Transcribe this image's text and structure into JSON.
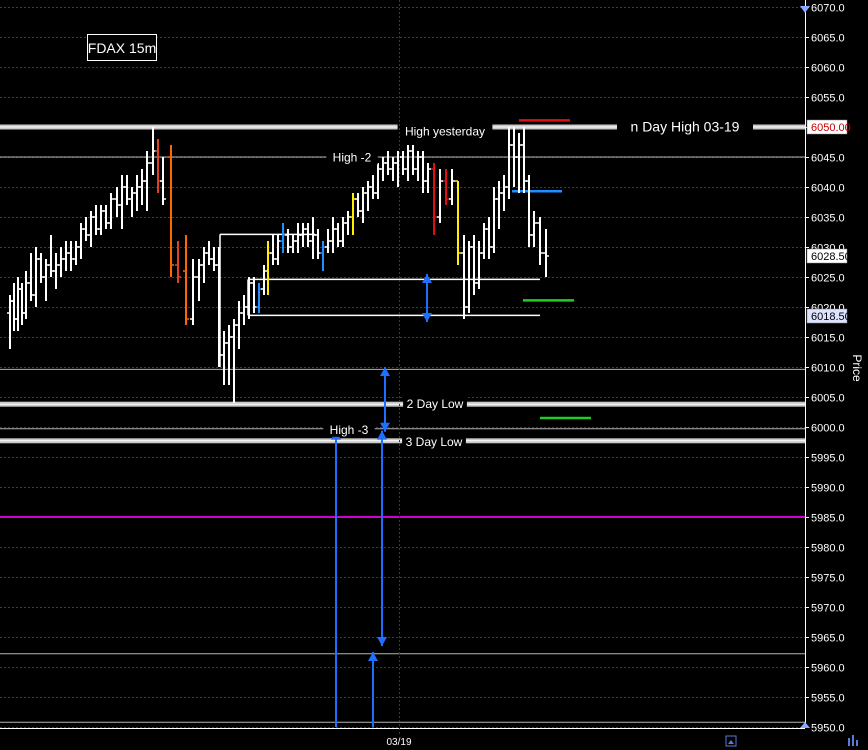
{
  "chart_data": {
    "type": "ohlc",
    "title": "FDAX 15m",
    "ylabel": "Price",
    "x_tick_label": "03/19",
    "ylim": [
      5950,
      6070
    ],
    "yticks": [
      5950,
      5955,
      5960,
      5965,
      5970,
      5975,
      5980,
      5985,
      5990,
      5995,
      6000,
      6005,
      6010,
      6015,
      6020,
      6025,
      6030,
      6035,
      6040,
      6045,
      6050,
      6055,
      6060,
      6065,
      6070
    ],
    "price_badges": [
      {
        "label": "6050.00",
        "value": 6050.0,
        "bg": "#ffffff",
        "fg": "#cc0000"
      },
      {
        "label": "6028.50",
        "value": 6028.5,
        "bg": "#ffffff",
        "fg": "#000000"
      },
      {
        "label": "6018.50",
        "value": 6018.5,
        "bg": "#dde2ff",
        "fg": "#000000"
      }
    ],
    "levels": [
      {
        "name": "High yesterday",
        "value": 6050.0,
        "label": "High yesterday",
        "label_price": 6049.4,
        "color": "#c8c8c8",
        "width": 3,
        "x_from": 0,
        "x_to": 1
      },
      {
        "name": "n Day High 03-19",
        "value": 6050.0,
        "label": "n Day High 03-19",
        "label_price": 6050.1,
        "color": "#c8c8c8",
        "width": 0,
        "x_from": 0,
        "x_to": 1
      },
      {
        "name": "High -2",
        "value": 6045.0,
        "label": "High -2",
        "label_price": 6045.1,
        "color": "#b4b4b4",
        "width": 1,
        "x_from": 0,
        "x_to": 1
      },
      {
        "name": "2 Day Low",
        "value": 6003.8,
        "label": "2 Day Low",
        "label_price": 6004.0,
        "color": "#c8c8c8",
        "width": 3,
        "x_from": 0,
        "x_to": 1
      },
      {
        "name": "High -3",
        "value": 5999.7,
        "label": "High -3",
        "label_price": 5999.7,
        "color": "#b4b4b4",
        "width": 1,
        "x_from": 0,
        "x_to": 1
      },
      {
        "name": "3 Day Low",
        "value": 5997.7,
        "label": "3 Day Low",
        "label_price": 5997.7,
        "color": "#c8c8c8",
        "width": 3,
        "x_from": 0,
        "x_to": 1
      },
      {
        "name": "magenta",
        "value": 5985.0,
        "label": "",
        "label_price": 5985.0,
        "color": "#d000d0",
        "width": 2,
        "x_from": 0,
        "x_to": 1
      },
      {
        "name": "line-6009",
        "value": 6009.6,
        "label": "",
        "label_price": 6009.6,
        "color": "#b4b4b4",
        "width": 1,
        "x_from": 0,
        "x_to": 1
      },
      {
        "name": "line-5962",
        "value": 5962.2,
        "label": "",
        "label_price": 5962.2,
        "color": "#b4b4b4",
        "width": 1,
        "x_from": 0,
        "x_to": 1
      },
      {
        "name": "line-5951",
        "value": 5950.8,
        "label": "",
        "label_price": 5950.8,
        "color": "#b4b4b4",
        "width": 1,
        "x_from": 0,
        "x_to": 1
      }
    ],
    "segments": [
      {
        "x1": 220,
        "x2": 315,
        "value": 6032.1,
        "color": "#ffffff"
      },
      {
        "x1": 248,
        "x2": 540,
        "value": 6024.6,
        "color": "#ffffff"
      },
      {
        "x1": 250,
        "x2": 540,
        "value": 6018.6,
        "color": "#ffffff"
      },
      {
        "x1": 519,
        "x2": 570,
        "value": 6051.1,
        "color": "#e01010"
      },
      {
        "x1": 512,
        "x2": 562,
        "value": 6039.3,
        "color": "#1e90ff"
      },
      {
        "x1": 523,
        "x2": 574,
        "value": 6021.1,
        "color": "#22cc22"
      },
      {
        "x1": 540,
        "x2": 591,
        "value": 6001.5,
        "color": "#22cc22"
      }
    ],
    "arrows": [
      {
        "x": 427,
        "v1": 6025.5,
        "v2": 6017.5,
        "type": "double",
        "color": "#1e6fff"
      },
      {
        "x": 385,
        "v1": 6010.0,
        "v2": 5999.2,
        "type": "double",
        "color": "#1e6fff"
      },
      {
        "x": 382,
        "v1": 5999.4,
        "v2": 5963.5,
        "type": "double",
        "color": "#1e6fff"
      },
      {
        "x": 336,
        "v1": 5950.0,
        "v2": 5999.4,
        "type": "up",
        "color": "#1e6fff"
      },
      {
        "x": 373,
        "v1": 5950.0,
        "v2": 5962.5,
        "type": "up",
        "color": "#1e6fff"
      }
    ],
    "bars": [
      {
        "x": 10,
        "o": 6019,
        "h": 6022,
        "l": 6013,
        "c": 6021,
        "color": "#ffffff"
      },
      {
        "x": 14,
        "o": 6021,
        "h": 6024,
        "l": 6016,
        "c": 6018,
        "color": "#ffffff"
      },
      {
        "x": 18,
        "o": 6018,
        "h": 6025,
        "l": 6016,
        "c": 6023,
        "color": "#ffffff"
      },
      {
        "x": 22,
        "o": 6023,
        "h": 6024,
        "l": 6017,
        "c": 6019,
        "color": "#ffffff"
      },
      {
        "x": 26,
        "o": 6019,
        "h": 6026,
        "l": 6018,
        "c": 6024,
        "color": "#ffffff"
      },
      {
        "x": 31,
        "o": 6024,
        "h": 6029,
        "l": 6021,
        "c": 6022,
        "color": "#ffffff"
      },
      {
        "x": 36,
        "o": 6022,
        "h": 6030,
        "l": 6020,
        "c": 6028,
        "color": "#ffffff"
      },
      {
        "x": 41,
        "o": 6028,
        "h": 6029,
        "l": 6024,
        "c": 6025,
        "color": "#ffffff"
      },
      {
        "x": 46,
        "o": 6025,
        "h": 6028,
        "l": 6021,
        "c": 6027,
        "color": "#ffffff"
      },
      {
        "x": 51,
        "o": 6027,
        "h": 6032,
        "l": 6025,
        "c": 6026,
        "color": "#ffffff"
      },
      {
        "x": 56,
        "o": 6026,
        "h": 6029,
        "l": 6023,
        "c": 6027,
        "color": "#ffffff"
      },
      {
        "x": 61,
        "o": 6027,
        "h": 6030,
        "l": 6025,
        "c": 6028,
        "color": "#ffffff"
      },
      {
        "x": 66,
        "o": 6028,
        "h": 6031,
        "l": 6026,
        "c": 6029,
        "color": "#ffffff"
      },
      {
        "x": 71,
        "o": 6029,
        "h": 6031,
        "l": 6026,
        "c": 6028,
        "color": "#ffffff"
      },
      {
        "x": 76,
        "o": 6028,
        "h": 6031,
        "l": 6027,
        "c": 6030,
        "color": "#ffffff"
      },
      {
        "x": 81,
        "o": 6030,
        "h": 6034,
        "l": 6028,
        "c": 6033,
        "color": "#ffffff"
      },
      {
        "x": 86,
        "o": 6033,
        "h": 6035,
        "l": 6031,
        "c": 6032,
        "color": "#ffffff"
      },
      {
        "x": 91,
        "o": 6032,
        "h": 6036,
        "l": 6030,
        "c": 6035,
        "color": "#ffffff"
      },
      {
        "x": 96,
        "o": 6035,
        "h": 6037,
        "l": 6032,
        "c": 6033,
        "color": "#ffffff"
      },
      {
        "x": 101,
        "o": 6033,
        "h": 6037,
        "l": 6032,
        "c": 6036,
        "color": "#ffffff"
      },
      {
        "x": 106,
        "o": 6036,
        "h": 6037,
        "l": 6033,
        "c": 6034,
        "color": "#ffffff"
      },
      {
        "x": 111,
        "o": 6034,
        "h": 6039,
        "l": 6033,
        "c": 6038,
        "color": "#ffffff"
      },
      {
        "x": 117,
        "o": 6038,
        "h": 6040,
        "l": 6035,
        "c": 6037,
        "color": "#ffffff"
      },
      {
        "x": 122,
        "o": 6037,
        "h": 6042,
        "l": 6033,
        "c": 6040,
        "color": "#ffffff"
      },
      {
        "x": 127,
        "o": 6040,
        "h": 6042,
        "l": 6037,
        "c": 6038,
        "color": "#ffffff"
      },
      {
        "x": 132,
        "o": 6038,
        "h": 6040,
        "l": 6035,
        "c": 6039,
        "color": "#ffffff"
      },
      {
        "x": 137,
        "o": 6039,
        "h": 6042,
        "l": 6036,
        "c": 6040,
        "color": "#ffffff"
      },
      {
        "x": 142,
        "o": 6040,
        "h": 6043,
        "l": 6037,
        "c": 6041,
        "color": "#ffffff"
      },
      {
        "x": 147,
        "o": 6041,
        "h": 6046,
        "l": 6036,
        "c": 6044,
        "color": "#ffffff"
      },
      {
        "x": 153,
        "o": 6044,
        "h": 6050,
        "l": 6042,
        "c": 6046,
        "color": "#ffffff"
      },
      {
        "x": 158,
        "o": 6046,
        "h": 6048,
        "l": 6039,
        "c": 6041,
        "color": "#e04020"
      },
      {
        "x": 163,
        "o": 6041,
        "h": 6045,
        "l": 6037,
        "c": 6038,
        "color": "#ffffff"
      },
      {
        "x": 171,
        "o": 6045,
        "h": 6047,
        "l": 6025,
        "c": 6027,
        "color": "#ff6600"
      },
      {
        "x": 178,
        "o": 6027,
        "h": 6031,
        "l": 6024,
        "c": 6025,
        "color": "#e04020"
      },
      {
        "x": 186,
        "o": 6026,
        "h": 6032,
        "l": 6017,
        "c": 6018,
        "color": "#ff6600"
      },
      {
        "x": 193,
        "o": 6018,
        "h": 6028,
        "l": 6017,
        "c": 6025,
        "color": "#ffffff"
      },
      {
        "x": 199,
        "o": 6025,
        "h": 6028,
        "l": 6021,
        "c": 6027,
        "color": "#ffffff"
      },
      {
        "x": 204,
        "o": 6027,
        "h": 6030,
        "l": 6024,
        "c": 6029,
        "color": "#ffffff"
      },
      {
        "x": 209,
        "o": 6029,
        "h": 6031,
        "l": 6027,
        "c": 6028,
        "color": "#ffffff"
      },
      {
        "x": 214,
        "o": 6028,
        "h": 6030,
        "l": 6026,
        "c": 6027,
        "color": "#ffffff"
      },
      {
        "x": 219,
        "o": 6027,
        "h": 6030,
        "l": 6010,
        "c": 6012,
        "color": "#ffffff"
      },
      {
        "x": 224,
        "o": 6012,
        "h": 6016,
        "l": 6007,
        "c": 6014,
        "color": "#ffffff"
      },
      {
        "x": 229,
        "o": 6014,
        "h": 6017,
        "l": 6007,
        "c": 6015,
        "color": "#ffffff"
      },
      {
        "x": 234,
        "o": 6015,
        "h": 6018,
        "l": 6004,
        "c": 6017,
        "color": "#ffffff"
      },
      {
        "x": 239,
        "o": 6017,
        "h": 6021,
        "l": 6013,
        "c": 6019,
        "color": "#ffffff"
      },
      {
        "x": 244,
        "o": 6019,
        "h": 6022,
        "l": 6017,
        "c": 6020,
        "color": "#ffffff"
      },
      {
        "x": 249,
        "o": 6020,
        "h": 6025,
        "l": 6018,
        "c": 6024,
        "color": "#ffffff"
      },
      {
        "x": 254,
        "o": 6024,
        "h": 6025,
        "l": 6019,
        "c": 6020,
        "color": "#ffffff"
      },
      {
        "x": 259,
        "o": 6020,
        "h": 6024,
        "l": 6019,
        "c": 6023,
        "color": "#1e90ff"
      },
      {
        "x": 264,
        "o": 6023,
        "h": 6027,
        "l": 6022,
        "c": 6026,
        "color": "#ffffff"
      },
      {
        "x": 268,
        "o": 6026,
        "h": 6031,
        "l": 6022,
        "c": 6029,
        "color": "#ffee00"
      },
      {
        "x": 273,
        "o": 6029,
        "h": 6032,
        "l": 6027,
        "c": 6028,
        "color": "#ffffff"
      },
      {
        "x": 278,
        "o": 6028,
        "h": 6032,
        "l": 6027,
        "c": 6031,
        "color": "#ffffff"
      },
      {
        "x": 283,
        "o": 6031,
        "h": 6034,
        "l": 6029,
        "c": 6032,
        "color": "#1e90ff"
      },
      {
        "x": 288,
        "o": 6032,
        "h": 6033,
        "l": 6029,
        "c": 6030,
        "color": "#ffffff"
      },
      {
        "x": 293,
        "o": 6030,
        "h": 6032,
        "l": 6029,
        "c": 6031,
        "color": "#ffffff"
      },
      {
        "x": 298,
        "o": 6031,
        "h": 6034,
        "l": 6029,
        "c": 6032,
        "color": "#ffffff"
      },
      {
        "x": 303,
        "o": 6032,
        "h": 6034,
        "l": 6030,
        "c": 6033,
        "color": "#ffffff"
      },
      {
        "x": 308,
        "o": 6033,
        "h": 6034,
        "l": 6030,
        "c": 6031,
        "color": "#ffffff"
      },
      {
        "x": 313,
        "o": 6031,
        "h": 6035,
        "l": 6028,
        "c": 6032,
        "color": "#ffffff"
      },
      {
        "x": 318,
        "o": 6032,
        "h": 6033,
        "l": 6028,
        "c": 6029,
        "color": "#ffffff"
      },
      {
        "x": 323,
        "o": 6029,
        "h": 6031,
        "l": 6026,
        "c": 6030,
        "color": "#1e90ff"
      },
      {
        "x": 328,
        "o": 6030,
        "h": 6033,
        "l": 6029,
        "c": 6031,
        "color": "#ffffff"
      },
      {
        "x": 333,
        "o": 6031,
        "h": 6035,
        "l": 6029,
        "c": 6033,
        "color": "#ffffff"
      },
      {
        "x": 338,
        "o": 6033,
        "h": 6034,
        "l": 6030,
        "c": 6031,
        "color": "#ffffff"
      },
      {
        "x": 343,
        "o": 6031,
        "h": 6035,
        "l": 6030,
        "c": 6034,
        "color": "#ffffff"
      },
      {
        "x": 348,
        "o": 6034,
        "h": 6036,
        "l": 6032,
        "c": 6035,
        "color": "#ffffff"
      },
      {
        "x": 353,
        "o": 6035,
        "h": 6039,
        "l": 6032,
        "c": 6038,
        "color": "#ffee00"
      },
      {
        "x": 358,
        "o": 6038,
        "h": 6039,
        "l": 6035,
        "c": 6036,
        "color": "#ffffff"
      },
      {
        "x": 363,
        "o": 6036,
        "h": 6040,
        "l": 6034,
        "c": 6039,
        "color": "#ffffff"
      },
      {
        "x": 368,
        "o": 6039,
        "h": 6041,
        "l": 6036,
        "c": 6040,
        "color": "#ffffff"
      },
      {
        "x": 373,
        "o": 6040,
        "h": 6042,
        "l": 6038,
        "c": 6039,
        "color": "#ffffff"
      },
      {
        "x": 378,
        "o": 6039,
        "h": 6044,
        "l": 6038,
        "c": 6043,
        "color": "#ffffff"
      },
      {
        "x": 383,
        "o": 6043,
        "h": 6045,
        "l": 6041,
        "c": 6044,
        "color": "#ffffff"
      },
      {
        "x": 388,
        "o": 6044,
        "h": 6046,
        "l": 6042,
        "c": 6043,
        "color": "#ffffff"
      },
      {
        "x": 393,
        "o": 6043,
        "h": 6045,
        "l": 6041,
        "c": 6044,
        "color": "#ffffff"
      },
      {
        "x": 398,
        "o": 6044,
        "h": 6046,
        "l": 6040,
        "c": 6045,
        "color": "#ffffff"
      },
      {
        "x": 403,
        "o": 6045,
        "h": 6046,
        "l": 6042,
        "c": 6043,
        "color": "#ffffff"
      },
      {
        "x": 408,
        "o": 6043,
        "h": 6047,
        "l": 6041,
        "c": 6046,
        "color": "#ffffff"
      },
      {
        "x": 413,
        "o": 6046,
        "h": 6047,
        "l": 6042,
        "c": 6043,
        "color": "#ffffff"
      },
      {
        "x": 418,
        "o": 6043,
        "h": 6046,
        "l": 6041,
        "c": 6045,
        "color": "#ffffff"
      },
      {
        "x": 423,
        "o": 6045,
        "h": 6046,
        "l": 6039,
        "c": 6041,
        "color": "#ffffff"
      },
      {
        "x": 428,
        "o": 6041,
        "h": 6044,
        "l": 6039,
        "c": 6043,
        "color": "#ffffff"
      },
      {
        "x": 434,
        "o": 6043,
        "h": 6044,
        "l": 6032,
        "c": 6035,
        "color": "#e01010"
      },
      {
        "x": 440,
        "o": 6035,
        "h": 6043,
        "l": 6034,
        "c": 6041,
        "color": "#ffffff"
      },
      {
        "x": 446,
        "o": 6041,
        "h": 6043,
        "l": 6037,
        "c": 6038,
        "color": "#e01010"
      },
      {
        "x": 452,
        "o": 6038,
        "h": 6043,
        "l": 6037,
        "c": 6041,
        "color": "#ffffff"
      },
      {
        "x": 458,
        "o": 6041,
        "h": 6041,
        "l": 6027,
        "c": 6029,
        "color": "#ffee00"
      },
      {
        "x": 464,
        "o": 6029,
        "h": 6032,
        "l": 6018,
        "c": 6020,
        "color": "#ffffff"
      },
      {
        "x": 469,
        "o": 6020,
        "h": 6031,
        "l": 6019,
        "c": 6030,
        "color": "#ffffff"
      },
      {
        "x": 474,
        "o": 6030,
        "h": 6032,
        "l": 6022,
        "c": 6024,
        "color": "#ffffff"
      },
      {
        "x": 479,
        "o": 6024,
        "h": 6031,
        "l": 6023,
        "c": 6029,
        "color": "#ffffff"
      },
      {
        "x": 484,
        "o": 6029,
        "h": 6034,
        "l": 6028,
        "c": 6033,
        "color": "#ffffff"
      },
      {
        "x": 489,
        "o": 6033,
        "h": 6035,
        "l": 6028,
        "c": 6030,
        "color": "#ffffff"
      },
      {
        "x": 494,
        "o": 6030,
        "h": 6040,
        "l": 6029,
        "c": 6038,
        "color": "#ffffff"
      },
      {
        "x": 499,
        "o": 6038,
        "h": 6041,
        "l": 6033,
        "c": 6039,
        "color": "#ffffff"
      },
      {
        "x": 504,
        "o": 6039,
        "h": 6042,
        "l": 6036,
        "c": 6040,
        "color": "#ffffff"
      },
      {
        "x": 509,
        "o": 6040,
        "h": 6050,
        "l": 6038,
        "c": 6047,
        "color": "#ffffff"
      },
      {
        "x": 514,
        "o": 6047,
        "h": 6050,
        "l": 6040,
        "c": 6045,
        "color": "#ffffff"
      },
      {
        "x": 519,
        "o": 6045,
        "h": 6049,
        "l": 6039,
        "c": 6047,
        "color": "#ffffff"
      },
      {
        "x": 524,
        "o": 6047,
        "h": 6050,
        "l": 6039,
        "c": 6041,
        "color": "#ffffff"
      },
      {
        "x": 529,
        "o": 6041,
        "h": 6042,
        "l": 6030,
        "c": 6032,
        "color": "#ffffff"
      },
      {
        "x": 534,
        "o": 6032,
        "h": 6036,
        "l": 6030,
        "c": 6034,
        "color": "#ffffff"
      },
      {
        "x": 540,
        "o": 6034,
        "h": 6035,
        "l": 6027,
        "c": 6029,
        "color": "#ffffff"
      },
      {
        "x": 546,
        "o": 6029,
        "h": 6033,
        "l": 6025,
        "c": 6028.5,
        "color": "#ffffff"
      }
    ]
  }
}
